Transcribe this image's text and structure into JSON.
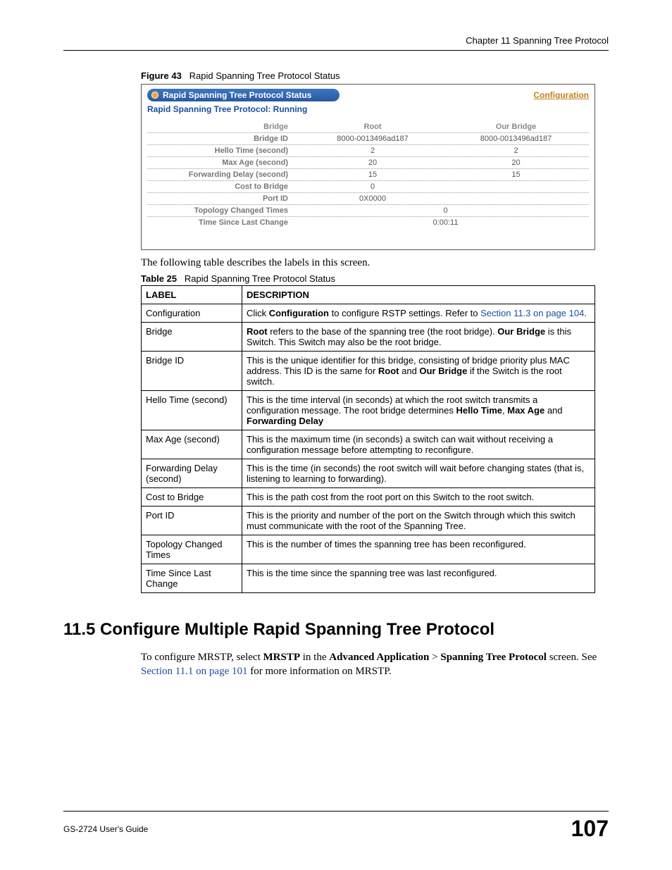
{
  "header": {
    "chapter": "Chapter 11 Spanning Tree Protocol"
  },
  "figure": {
    "label": "Figure 43",
    "title": "Rapid Spanning Tree Protocol Status",
    "pill_title": "Rapid Spanning Tree Protocol Status",
    "config_link": "Configuration",
    "running_line": "Rapid Spanning Tree Protocol: Running",
    "cols": {
      "c1": "Bridge",
      "c2": "Root",
      "c3": "Our Bridge"
    },
    "rows": [
      {
        "label": "Bridge ID",
        "root": "8000-0013496ad187",
        "our": "8000-0013496ad187"
      },
      {
        "label": "Hello Time (second)",
        "root": "2",
        "our": "2"
      },
      {
        "label": "Max Age (second)",
        "root": "20",
        "our": "20"
      },
      {
        "label": "Forwarding Delay (second)",
        "root": "15",
        "our": "15"
      },
      {
        "label": "Cost to Bridge",
        "root": "0",
        "our": ""
      },
      {
        "label": "Port ID",
        "root": "0X0000",
        "our": ""
      }
    ],
    "wide_rows": [
      {
        "label": "Topology Changed Times",
        "value": "0"
      },
      {
        "label": "Time Since Last Change",
        "value": "0:00:11"
      }
    ]
  },
  "para1": "The following table describes the labels in this screen.",
  "table25": {
    "label": "Table 25",
    "title": "Rapid Spanning Tree Protocol Status",
    "head": {
      "c1": "LABEL",
      "c2": "DESCRIPTION"
    },
    "rows": [
      {
        "label": "Configuration",
        "desc_pre": "Click ",
        "b1": "Configuration",
        "desc_mid": " to configure RSTP settings. Refer to ",
        "link": "Section 11.3 on page 104",
        "desc_post": "."
      },
      {
        "label": "Bridge",
        "b1": "Root",
        "t1": " refers to the base of the spanning tree (the root bridge). ",
        "b2": "Our Bridge",
        "t2": " is this Switch. This Switch may also be the root bridge."
      },
      {
        "label": "Bridge ID",
        "t1": "This is the unique identifier for this bridge, consisting of bridge priority plus MAC address. This ID is the same for ",
        "b1": "Root",
        "t2": " and ",
        "b2": "Our Bridge",
        "t3": " if the Switch is the root switch."
      },
      {
        "label": "Hello Time (second)",
        "t1": "This is the time interval (in seconds) at which the root switch transmits a configuration message. The root bridge determines ",
        "b1": "Hello Time",
        "t2": ", ",
        "b2": "Max Age",
        "t3": " and ",
        "b3": "Forwarding Delay"
      },
      {
        "label": "Max Age (second)",
        "t1": "This is the maximum time (in seconds) a switch can wait without receiving a configuration message before attempting to reconfigure."
      },
      {
        "label": "Forwarding Delay (second)",
        "t1": "This is the time (in seconds) the root switch will wait before changing states (that is, listening to learning to forwarding)."
      },
      {
        "label": "Cost to Bridge",
        "t1": "This is the path cost from the root port on this Switch to the root switch."
      },
      {
        "label": "Port ID",
        "t1": "This is the priority and number of the port on the Switch through which this switch must communicate with the root of the Spanning Tree."
      },
      {
        "label": "Topology Changed Times",
        "t1": "This is the number of times the spanning tree has been reconfigured."
      },
      {
        "label": "Time Since Last Change",
        "t1": "This is the time since the spanning tree was last reconfigured."
      }
    ]
  },
  "section": {
    "heading": "11.5  Configure Multiple Rapid Spanning Tree Protocol",
    "p_pre": "To configure MRSTP, select ",
    "b1": "MRSTP",
    "p_mid1": " in the ",
    "b2": "Advanced Application",
    "p_gt": " > ",
    "b3": "Spanning Tree Protocol",
    "p_mid2": " screen. See ",
    "link": "Section 11.1 on page 101",
    "p_post": " for more information on MRSTP."
  },
  "footer": {
    "guide": "GS-2724 User's Guide",
    "page": "107"
  }
}
